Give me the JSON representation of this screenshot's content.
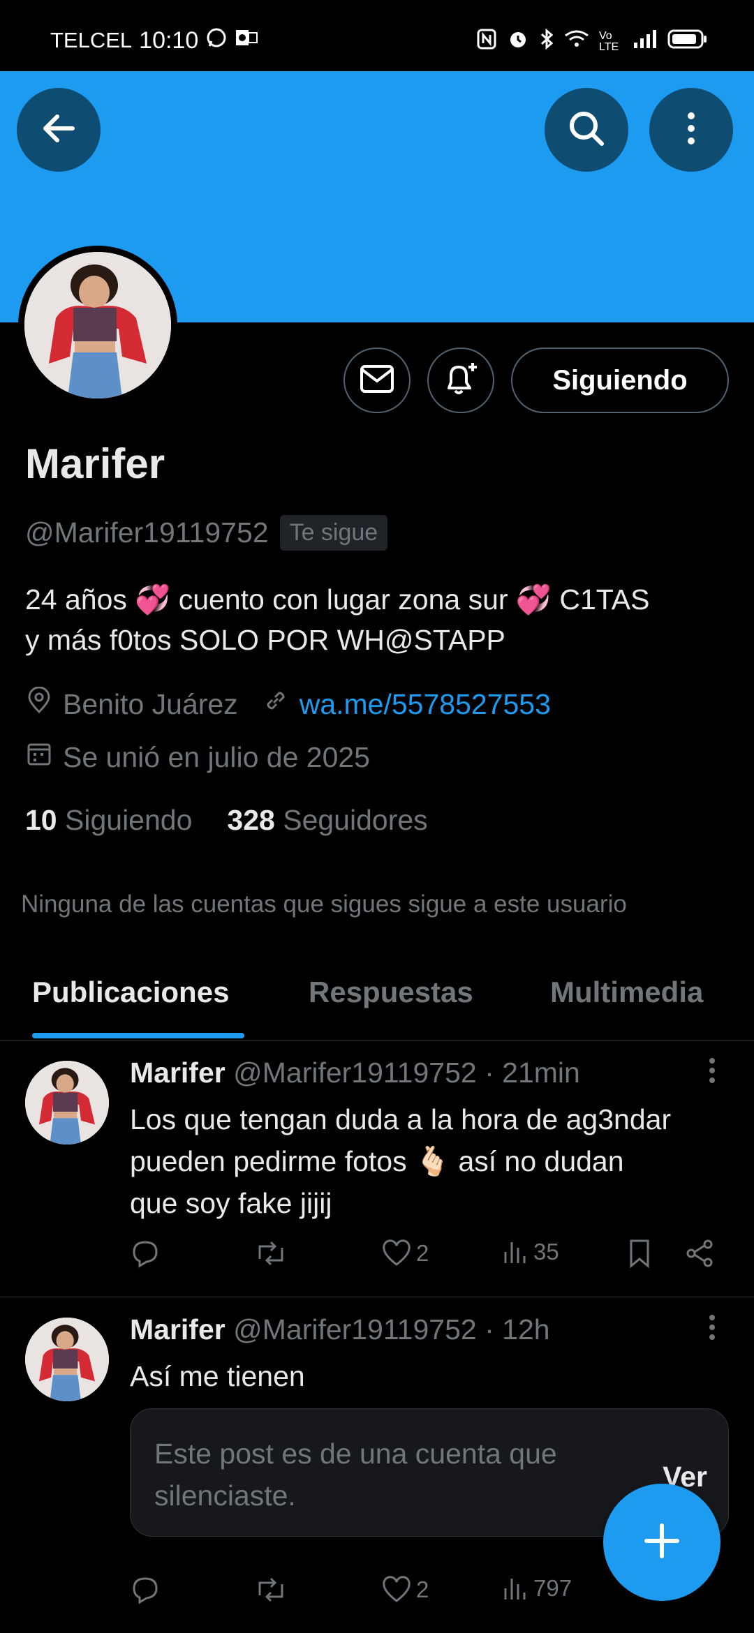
{
  "status_bar": {
    "carrier": "TELCEL",
    "time": "10:10",
    "network": "Vo LTE"
  },
  "header": {
    "back_icon": "arrow-left-icon",
    "search_icon": "search-icon",
    "more_icon": "more-vertical-icon",
    "banner_color": "#1d9bf0"
  },
  "profile": {
    "name": "Marifer",
    "handle": "@Marifer19119752",
    "follows_you": "Te sigue",
    "following_button": "Siguiendo",
    "bio_line1": "24 años 💞 cuento con lugar zona sur 💞 C1TAS",
    "bio_line2": "y más f0tos SOLO POR WH@STAPP",
    "location": "Benito Juárez",
    "website": "wa.me/5578527553",
    "joined": "Se unió en julio de 2025",
    "following_count": "10",
    "following_label": "Siguiendo",
    "followers_count": "328",
    "followers_label": "Seguidores",
    "mutuals_note": "Ninguna de las cuentas que sigues sigue a este usuario"
  },
  "tabs": [
    {
      "label": "Publicaciones",
      "active": true
    },
    {
      "label": "Respuestas",
      "active": false
    },
    {
      "label": "Multimedia",
      "active": false
    }
  ],
  "posts": [
    {
      "name": "Marifer",
      "handle": "@Marifer19119752",
      "time": "· 21min",
      "text_line1": "Los que tengan duda a la hora de ag3ndar",
      "text_line2": "pueden pedirme fotos 🫰🏻 así no dudan",
      "text_line3": "que soy fake jijij",
      "likes": "2",
      "views": "35"
    },
    {
      "name": "Marifer",
      "handle": "@Marifer19119752",
      "time": "· 12h",
      "text_line1": "Así me tienen",
      "muted_notice_line1": "Este post es de una cuenta que",
      "muted_notice_line2": "silenciaste.",
      "muted_action": "Ver",
      "likes": "2",
      "views": "797"
    }
  ],
  "fab": {
    "icon": "plus-icon",
    "color": "#1d9bf0"
  }
}
